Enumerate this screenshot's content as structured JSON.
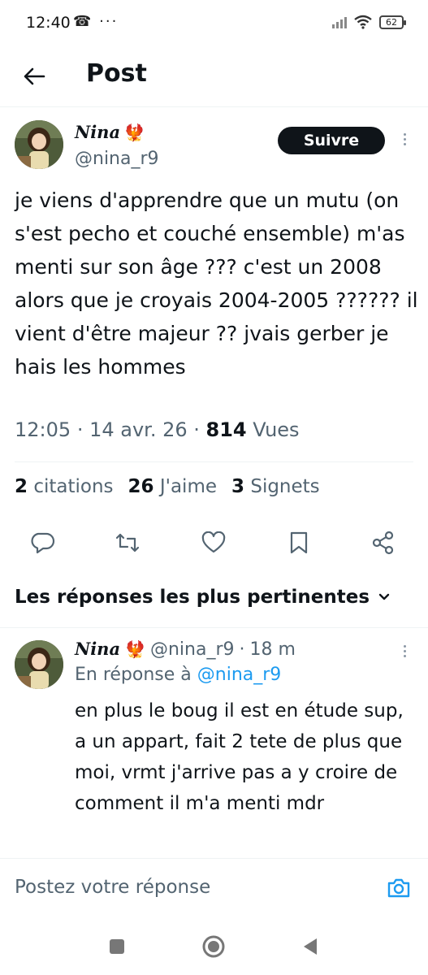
{
  "status_bar": {
    "time": "12:40",
    "left_icons": "☎ ···",
    "battery": "62"
  },
  "header": {
    "title": "Post"
  },
  "post": {
    "display_name": "Nina",
    "name_emoji": "🐦‍🔥",
    "handle": "@nina_r9",
    "follow_label": "Suivre",
    "text": "je viens d'apprendre que un mutu (on s'est pecho et couché ensemble) m'as menti sur son âge ??? c'est un 2008 alors que je croyais 2004-2005 ?????? il vient d'être majeur ?? jvais gerber je hais les hommes",
    "time": "12:05",
    "date": "14 avr. 26",
    "views_count": "814",
    "views_label": "Vues",
    "quotes_count": "2",
    "quotes_label": "citations",
    "likes_count": "26",
    "likes_label": "J'aime",
    "bookmarks_count": "3",
    "bookmarks_label": "Signets"
  },
  "sort": {
    "label": "Les réponses les plus pertinentes"
  },
  "reply": {
    "display_name": "Nina",
    "handle": "@nina_r9",
    "age": "18 m",
    "reply_prefix": "En réponse à",
    "reply_mention": "@nina_r9",
    "text": "en plus le boug il est en étude sup, a un appart, fait 2 tete de plus que moi, vrmt j'arrive pas a y croire de comment il m'a menti mdr"
  },
  "composer": {
    "placeholder": "Postez votre réponse"
  },
  "colors": {
    "accent": "#1d9bf0",
    "text_primary": "#0f1419",
    "text_secondary": "#536471",
    "divider": "#eff3f4"
  },
  "icons": [
    "back-arrow-icon",
    "reply-icon",
    "retweet-icon",
    "like-icon",
    "bookmark-icon",
    "share-icon",
    "chevron-down-icon",
    "camera-icon",
    "nav-square-icon",
    "nav-home-icon",
    "nav-back-icon",
    "more-vert-icon"
  ]
}
